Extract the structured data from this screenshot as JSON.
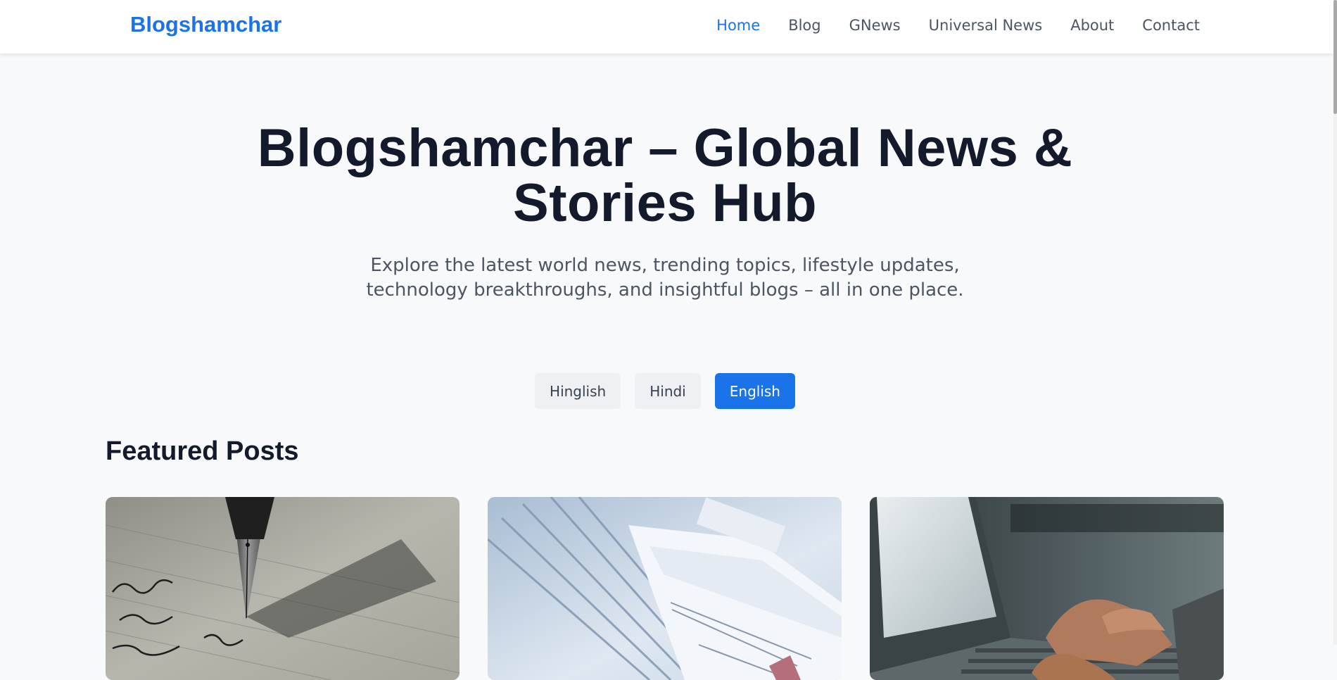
{
  "brand": "Blogshamchar",
  "nav": {
    "home": "Home",
    "blog": "Blog",
    "gnews": "GNews",
    "universal_news": "Universal News",
    "about": "About",
    "contact": "Contact"
  },
  "hero": {
    "title": "Blogshamchar – Global News & Stories Hub",
    "subtitle": "Explore the latest world news, trending topics, lifestyle updates, technology breakthroughs, and insightful blogs – all in one place."
  },
  "languages": {
    "hinglish": "Hinglish",
    "hindi": "Hindi",
    "english": "English",
    "selected": "English"
  },
  "featured": {
    "title": "Featured Posts"
  },
  "colors": {
    "accent": "#1a73e8",
    "heading": "#121a2b",
    "muted": "#4b5563"
  }
}
